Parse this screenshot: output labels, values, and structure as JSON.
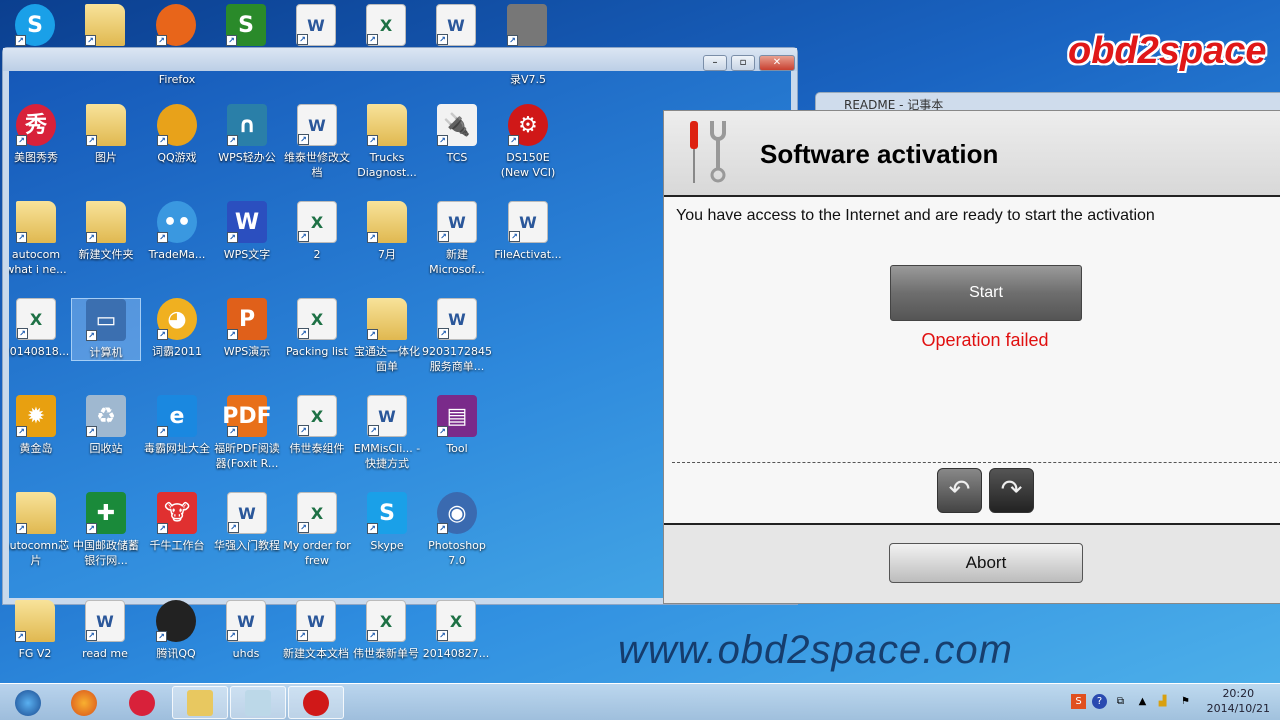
{
  "desktop": {
    "top_row": [
      {
        "label": "",
        "type": "skype",
        "color": "#1aa0e8"
      },
      {
        "label": "",
        "type": "folder"
      },
      {
        "label": "Firefox",
        "type": "firefox",
        "color": "#e8651a"
      },
      {
        "label": "",
        "type": "wps",
        "color": "#2a8a2a"
      },
      {
        "label": "",
        "type": "doc"
      },
      {
        "label": "",
        "type": "xls"
      },
      {
        "label": "",
        "type": "doc"
      },
      {
        "label": "录V7.5",
        "type": "camera",
        "color": "#777"
      }
    ],
    "window_icons": [
      {
        "label": "美图秀秀",
        "type": "round",
        "color": "#d8213a",
        "glyph": "秀"
      },
      {
        "label": "图片",
        "type": "folder"
      },
      {
        "label": "QQ游戏",
        "type": "qq",
        "color": "#e8a21a"
      },
      {
        "label": "WPS轻办公",
        "type": "app",
        "color": "#2a7fa8",
        "glyph": "∩"
      },
      {
        "label": "维泰世修改文档",
        "type": "doc"
      },
      {
        "label": "Trucks Diagnost...",
        "type": "folder"
      },
      {
        "label": "TCS",
        "type": "app",
        "color": "#f2f2f2",
        "glyph": "🔌"
      },
      {
        "label": "DS150E (New VCI)",
        "type": "round",
        "color": "#d01818",
        "glyph": "⚙"
      },
      {
        "label": "autocom what i ne...",
        "type": "folder"
      },
      {
        "label": "新建文件夹",
        "type": "folder"
      },
      {
        "label": "TradeMa...",
        "type": "round",
        "color": "#3a98e0",
        "glyph": "••"
      },
      {
        "label": "WPS文字",
        "type": "app",
        "color": "#2b4fbf",
        "glyph": "W"
      },
      {
        "label": "2",
        "type": "xls"
      },
      {
        "label": "7月",
        "type": "folder"
      },
      {
        "label": "新建 Microsof...",
        "type": "doc"
      },
      {
        "label": "FileActivat...",
        "type": "doc"
      },
      {
        "label": "20140818...",
        "type": "xls"
      },
      {
        "label": "计算机",
        "type": "app",
        "color": "#3b6fb0",
        "glyph": "▭",
        "selected": true
      },
      {
        "label": "词霸2011",
        "type": "round",
        "color": "#f0b020",
        "glyph": "◕"
      },
      {
        "label": "WPS演示",
        "type": "app",
        "color": "#e0601a",
        "glyph": "P"
      },
      {
        "label": "Packing list",
        "type": "xls"
      },
      {
        "label": "宝通达一体化面单",
        "type": "folder"
      },
      {
        "label": "9203172845服务商单...",
        "type": "doc"
      },
      {
        "label": "",
        "type": "none"
      },
      {
        "label": "黄金岛",
        "type": "app",
        "color": "#e8a010",
        "glyph": "✹"
      },
      {
        "label": "回收站",
        "type": "app",
        "color": "#9fb8d0",
        "glyph": "♻"
      },
      {
        "label": "毒霸网址大全",
        "type": "app",
        "color": "#1a88e0",
        "glyph": "e"
      },
      {
        "label": "福昕PDF阅读器(Foxit R...",
        "type": "app",
        "color": "#e8701a",
        "glyph": "PDF"
      },
      {
        "label": "伟世泰组件",
        "type": "xls"
      },
      {
        "label": "EMMisCli... - 快捷方式",
        "type": "doc"
      },
      {
        "label": "Tool",
        "type": "app",
        "color": "#7a2a8a",
        "glyph": "▤"
      },
      {
        "label": "",
        "type": "none"
      },
      {
        "label": "autocomn芯片",
        "type": "folder"
      },
      {
        "label": "中国邮政储蓄银行网...",
        "type": "app",
        "color": "#1a8a3a",
        "glyph": "✚"
      },
      {
        "label": "千牛工作台",
        "type": "app",
        "color": "#e03030",
        "glyph": "🐮"
      },
      {
        "label": "华强入门教程",
        "type": "doc"
      },
      {
        "label": "My order for frew",
        "type": "xls"
      },
      {
        "label": "Skype",
        "type": "app",
        "color": "#1aa0e8",
        "glyph": "S"
      },
      {
        "label": "Photoshop 7.0",
        "type": "round",
        "color": "#3a6ab0",
        "glyph": "◉"
      }
    ],
    "bottom_row": [
      {
        "label": "FG V2",
        "type": "folder"
      },
      {
        "label": "read me",
        "type": "doc"
      },
      {
        "label": "腾讯QQ",
        "type": "qq",
        "color": "#222"
      },
      {
        "label": "uhds",
        "type": "doc"
      },
      {
        "label": "新建文本文档",
        "type": "doc"
      },
      {
        "label": "伟世泰新单号",
        "type": "xls"
      },
      {
        "label": "20140827...",
        "type": "xls"
      }
    ]
  },
  "background_window": {
    "title": "README - 记事本"
  },
  "dialog": {
    "title": "Software activation",
    "message": "You have access to the Internet and are ready to start the activation",
    "start_label": "Start",
    "status": "Operation failed",
    "status_color": "#e01010",
    "back_icon": "arrow-back",
    "forward_icon": "arrow-forward",
    "abort_label": "Abort"
  },
  "branding": {
    "logo": "obd2space",
    "watermark": "www.obd2space.com"
  },
  "taskbar": {
    "time": "20:20",
    "date": "2014/10/21"
  }
}
